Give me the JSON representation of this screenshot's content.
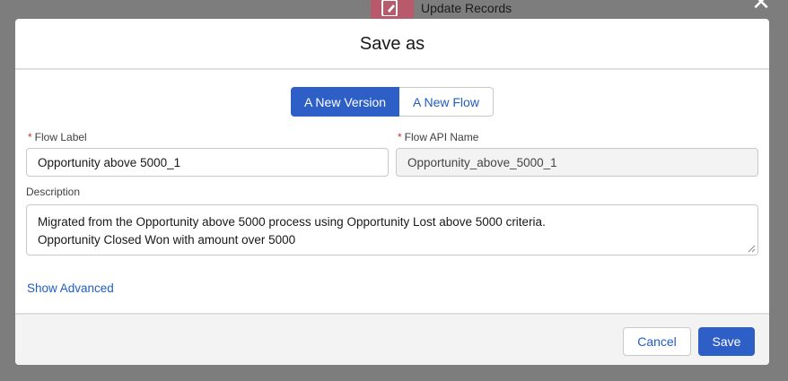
{
  "background": {
    "node_label": "Update Records",
    "node_color": "#b85a6c"
  },
  "modal": {
    "title": "Save as",
    "close_icon": "close-icon",
    "toggle": {
      "options": [
        "A New Version",
        "A New Flow"
      ],
      "selected": "A New Version"
    },
    "flow_label": {
      "label": "Flow Label",
      "required": "*",
      "value": "Opportunity above 5000_1"
    },
    "flow_api_name": {
      "label": "Flow API Name",
      "required": "*",
      "value": "Opportunity_above_5000_1"
    },
    "description": {
      "label": "Description",
      "lines": [
        "Migrated from the Opportunity above 5000 process using Opportunity Lost above 5000 criteria.",
        "Opportunity Closed Won with amount over 5000"
      ]
    },
    "show_advanced": "Show Advanced",
    "footer": {
      "cancel": "Cancel",
      "save": "Save"
    }
  },
  "colors": {
    "brand": "#2e5fc6",
    "link": "#1f5dc2",
    "required": "#c23934"
  }
}
